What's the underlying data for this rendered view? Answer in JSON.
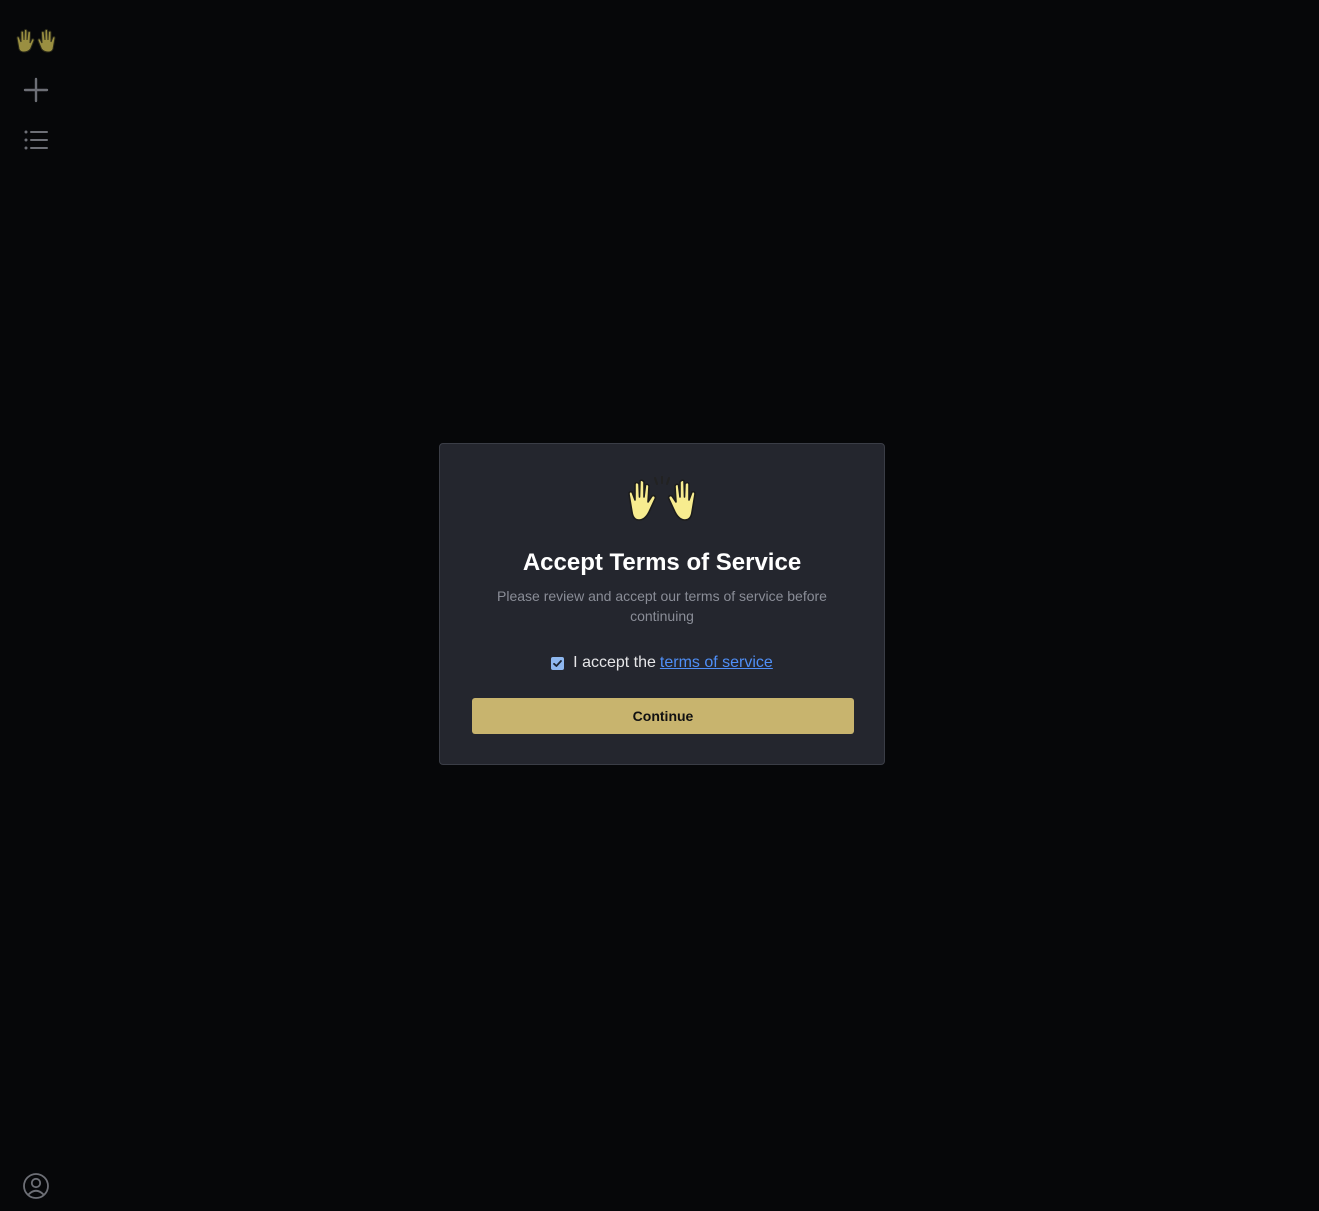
{
  "sidebar": {
    "logo_icon": "raising-hands-icon",
    "new_icon": "plus-icon",
    "list_icon": "list-icon",
    "account_icon": "user-circle-icon"
  },
  "modal": {
    "emoji_icon": "raising-hands-icon",
    "title": "Accept Terms of Service",
    "description": "Please review and accept our terms of service before continuing",
    "checkbox_checked": true,
    "accept_prefix": "I accept the",
    "tos_link": "terms of service",
    "continue_label": "Continue"
  },
  "colors": {
    "background": "#060709",
    "modal_bg": "#24262e",
    "accent_button": "#c8b46e",
    "link": "#4f8ff7",
    "checkbox": "#8fb8f0"
  }
}
